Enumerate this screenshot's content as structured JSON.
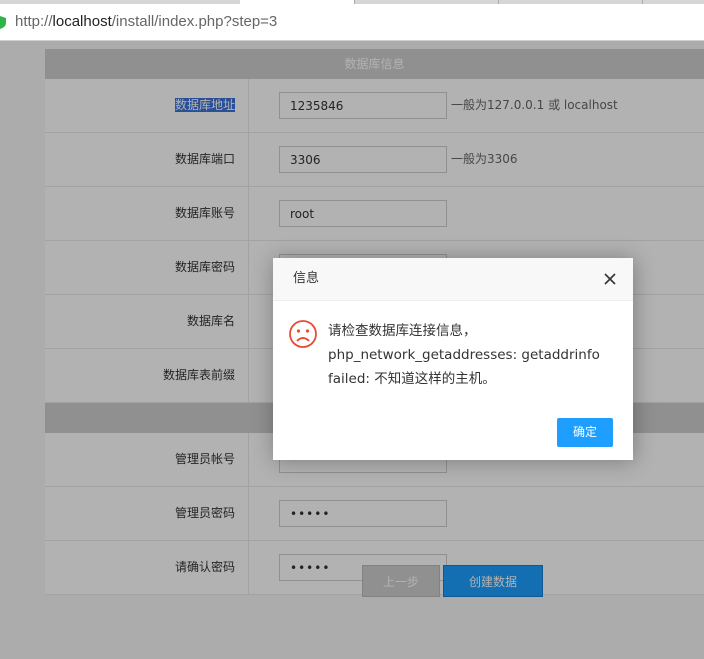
{
  "browser": {
    "url_prefix": "http://",
    "url_host": "localhost",
    "url_path": "/install/index.php?step=3"
  },
  "form": {
    "db_section_title": "数据库信息",
    "rows": [
      {
        "label": "数据库地址",
        "value": "1235846",
        "hint": "一般为127.0.0.1 或 localhost"
      },
      {
        "label": "数据库端口",
        "value": "3306",
        "hint": "一般为3306"
      },
      {
        "label": "数据库账号",
        "value": "root",
        "hint": ""
      },
      {
        "label": "数据库密码",
        "value": "",
        "hint": ""
      },
      {
        "label": "数据库名",
        "value": "",
        "hint": ""
      },
      {
        "label": "数据库表前缀",
        "value": "",
        "hint": ""
      }
    ],
    "admin_rows": [
      {
        "label": "管理员帐号",
        "value": ""
      },
      {
        "label": "管理员密码",
        "value": "•••••"
      },
      {
        "label": "请确认密码",
        "value": "•••••"
      }
    ],
    "prev_label": "上一步",
    "create_label": "创建数据"
  },
  "dialog": {
    "title": "信息",
    "message": "请检查数据库连接信息，php_network_getaddresses: getaddrinfo failed: 不知道这样的主机。",
    "ok_label": "确定"
  },
  "colors": {
    "accent": "#1e9fff",
    "error_icon": "#e94b35"
  }
}
